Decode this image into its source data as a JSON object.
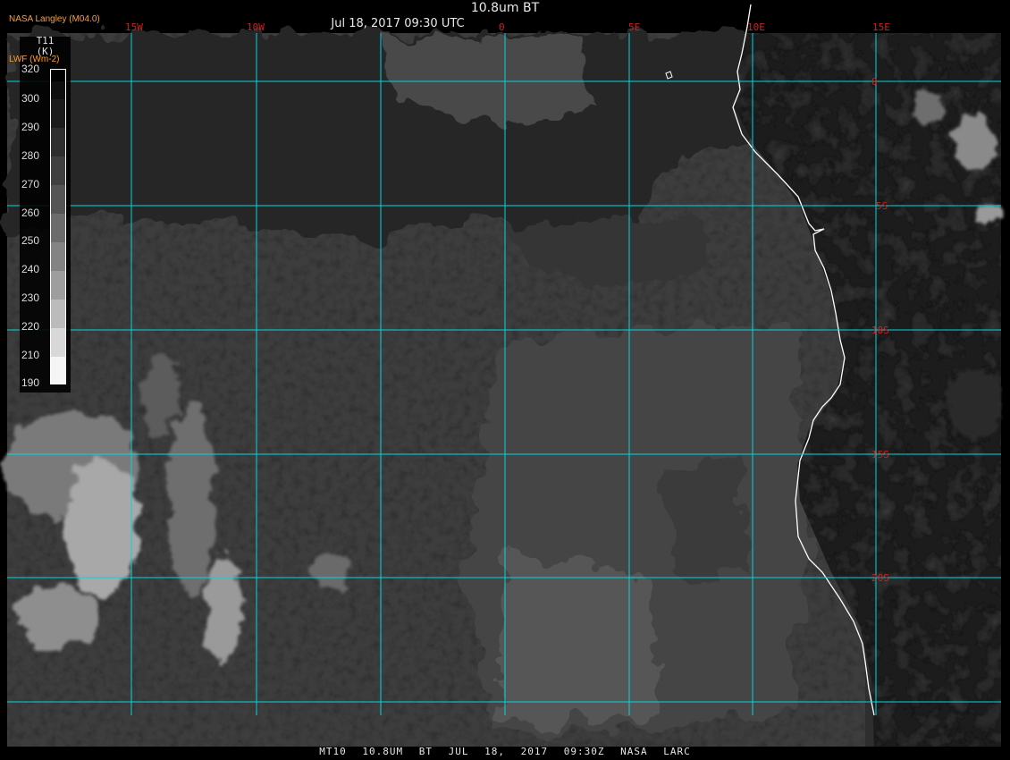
{
  "header": {
    "title": "10.8um BT",
    "date": "Jul 18, 2017 09:30 UTC",
    "agency": "NASA Langley (M04.0)",
    "units": "LWF (Wm-2)"
  },
  "legend": {
    "variable": "T11",
    "unit": "(K)",
    "labels": [
      "320",
      "300",
      "290",
      "280",
      "270",
      "260",
      "250",
      "240",
      "230",
      "220",
      "210",
      "190"
    ],
    "scale": "descending-grayscale"
  },
  "grid": {
    "lon_labels": [
      "15W",
      "10W",
      "0",
      "5E",
      "10E",
      "15E"
    ],
    "lat_labels": [
      "0",
      "5S",
      "10S",
      "15S",
      "20S"
    ],
    "line_color": "#00d8e0",
    "label_color": "#d02020"
  },
  "footer": {
    "text": "MT10 10.8UM BT JUL 18, 2017 09:30Z NASA LARC"
  },
  "colors": {
    "background": "#000000",
    "header_text": "#e8e8e8",
    "agency_text": "#ff9f2a",
    "coastline": "#ffffff"
  }
}
